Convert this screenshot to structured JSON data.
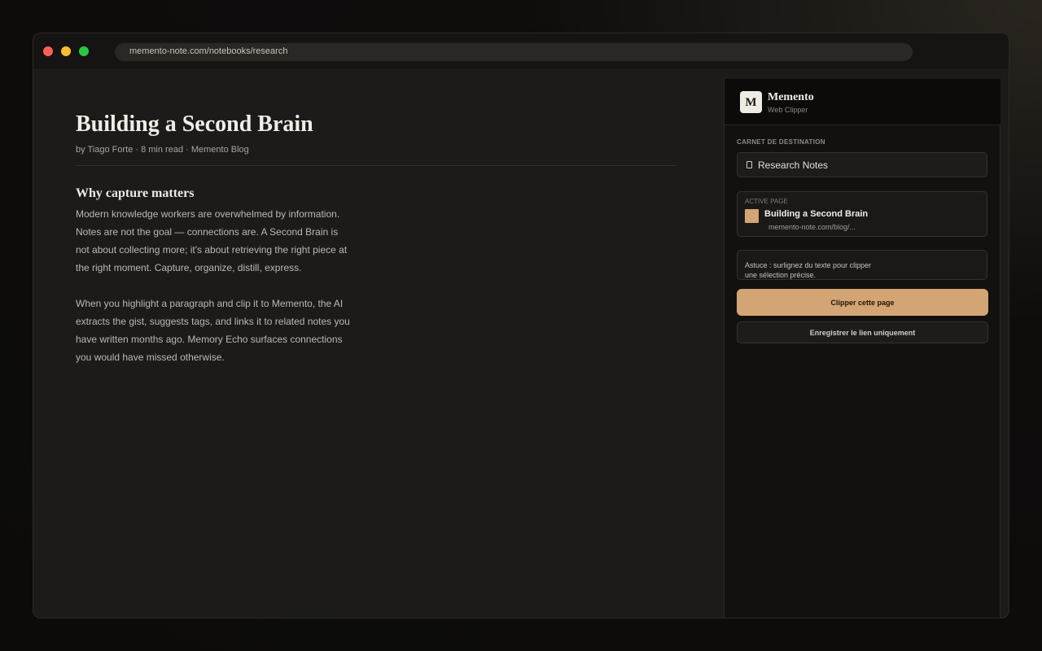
{
  "browser": {
    "url": "memento-note.com/notebooks/research"
  },
  "article": {
    "title": "Building a Second Brain",
    "byline": "by Tiago Forte · 8 min read · Memento Blog",
    "section_heading": "Why capture matters",
    "paragraph_1": "Modern knowledge workers are overwhelmed by information. Notes are not the goal — connections are. A Second Brain is not about collecting more; it's about retrieving the right piece at the right moment. Capture, organize, distill, express.",
    "paragraph_2": "When you highlight a paragraph and clip it to Memento, the AI extracts the gist, suggests tags, and links it to related notes you have written months ago. Memory Echo surfaces connections you would have missed otherwise."
  },
  "clipper": {
    "logo_letter": "M",
    "brand_name": "Memento",
    "brand_subtitle": "Web Clipper",
    "destination_label": "CARNET DE DESTINATION",
    "notebook_name": "Research Notes",
    "notebook_icon": "notebook-icon",
    "active_page_label": "ACTIVE PAGE",
    "active_page_title": "Building a Second Brain",
    "active_page_url": "memento-note.com/blog/...",
    "tip_text": "Astuce : surlignez du texte pour clipper une sélection précise.",
    "primary_button": "Clipper cette page",
    "secondary_button": "Enregistrer le lien uniquement"
  },
  "colors": {
    "accent": "#d4a574",
    "window_background": "#1c1b1a",
    "panel_background": "#121110"
  }
}
